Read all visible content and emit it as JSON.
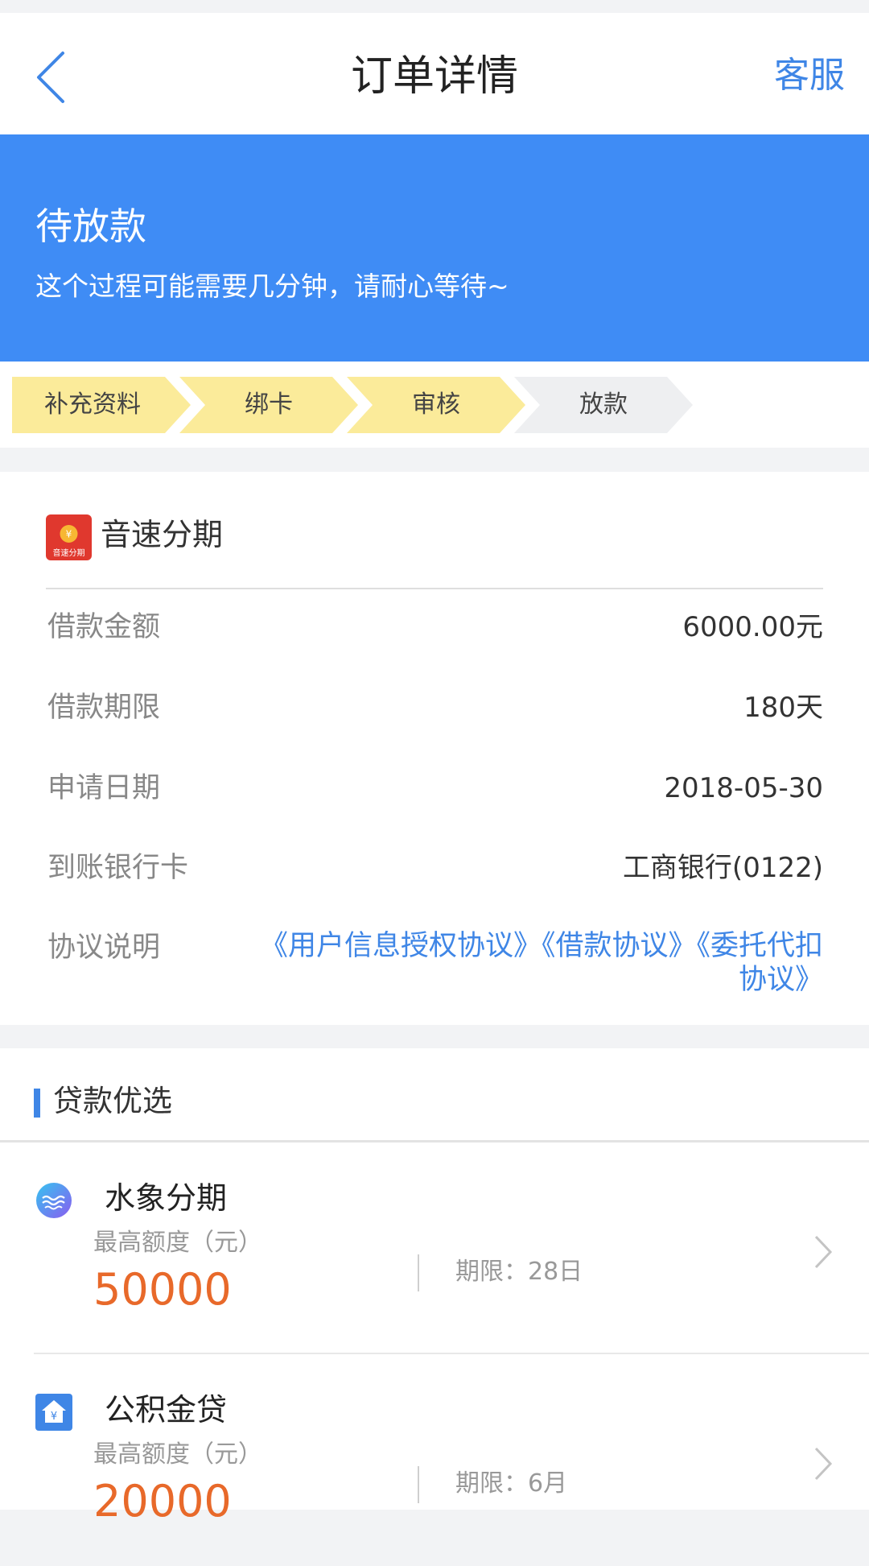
{
  "nav": {
    "title": "订单详情",
    "service_label": "客服"
  },
  "status": {
    "title": "待放款",
    "description": "这个过程可能需要几分钟，请耐心等待~"
  },
  "steps": [
    {
      "label": "补充资料",
      "done": true
    },
    {
      "label": "绑卡",
      "done": true
    },
    {
      "label": "审核",
      "done": true
    },
    {
      "label": "放款",
      "done": false
    }
  ],
  "order": {
    "lender_name": "音速分期",
    "logo_text": "音速分期",
    "logo_symbol": "¥",
    "rows": [
      {
        "label": "借款金额",
        "value": "6000.00元"
      },
      {
        "label": "借款期限",
        "value": "180天"
      },
      {
        "label": "申请日期",
        "value": "2018-05-30"
      },
      {
        "label": "到账银行卡",
        "value": "工商银行(0122)"
      }
    ],
    "agreement_label": "协议说明",
    "agreements": [
      "《用户信息授权协议》",
      "《借款协议》",
      "《委托代扣协议》"
    ]
  },
  "recommend": {
    "header": "贷款优选",
    "products": [
      {
        "name": "水象分期",
        "icon": "water-wave-icon",
        "limit_label": "最高额度（元）",
        "limit_value": "50000",
        "term": "期限：28日"
      },
      {
        "name": "公积金贷",
        "icon": "house-yen-icon",
        "limit_label": "最高额度（元）",
        "limit_value": "20000",
        "term": "期限：6月"
      }
    ]
  },
  "colors": {
    "primary": "#3f8cf5",
    "link": "#3f86e6",
    "step_done": "#fbeb9a",
    "step_pending": "#eeeff1",
    "amount": "#e8692a",
    "logo_red": "#e0382e"
  }
}
